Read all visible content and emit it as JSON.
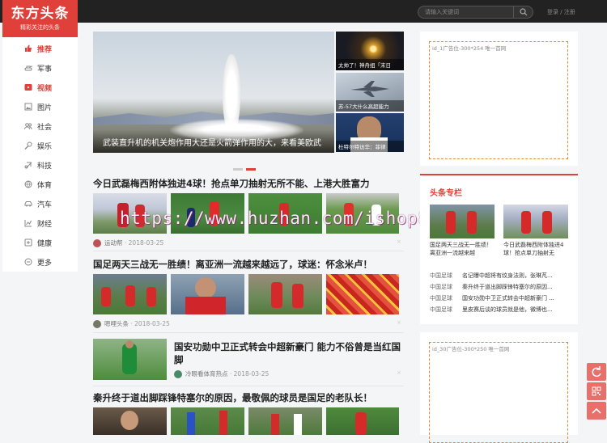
{
  "header": {
    "logo_title": "东方头条",
    "logo_slogan": "精彩关注的头条",
    "search_placeholder": "请输入关键词",
    "login": "登录 / 注册"
  },
  "sidebar": {
    "items": [
      {
        "label": "推荐",
        "icon": "thumb-up-icon",
        "active": true
      },
      {
        "label": "军事",
        "icon": "tank-icon"
      },
      {
        "label": "视频",
        "icon": "video-icon",
        "active": true
      },
      {
        "label": "图片",
        "icon": "image-icon"
      },
      {
        "label": "社会",
        "icon": "people-icon"
      },
      {
        "label": "娱乐",
        "icon": "microphone-icon"
      },
      {
        "label": "科技",
        "icon": "tech-icon"
      },
      {
        "label": "体育",
        "icon": "ball-icon"
      },
      {
        "label": "汽车",
        "icon": "car-icon"
      },
      {
        "label": "财经",
        "icon": "chart-icon"
      },
      {
        "label": "健康",
        "icon": "health-icon"
      },
      {
        "label": "更多",
        "icon": "more-icon"
      }
    ]
  },
  "hero": {
    "caption": "武装直升机的机关炮作用大还是火箭弹作用的大，来看美欧武"
  },
  "side_thumbs": [
    {
      "caption": "太帅了！神舟组「末日"
    },
    {
      "caption": "苏-57大什么高超能力"
    },
    {
      "caption": "杜特尔特访华：菲律"
    }
  ],
  "articles": [
    {
      "title": "今日武磊梅西附体独进4球！抢点单刀抽射无所不能、上港大胜富力",
      "source": "运动帮",
      "date": "2018-03-25"
    },
    {
      "title": "国足两天三战无一胜绩！离亚洲一流越来越远了，球迷：怀念米卢！",
      "source": "嗯哩头条",
      "date": "2018-03-25"
    },
    {
      "title": "国安功勋中卫正式转会中超新豪门 能力不俗曾是当红国脚",
      "source": "冷眼看体育热点",
      "date": "2018-03-25"
    },
    {
      "title": "秦升终于道出脚踩锋特塞尔的原因，最敬佩的球员是国足的老队长！"
    }
  ],
  "dismiss": "×",
  "watermark": "https://www.huzhan.com/ishop8803",
  "right": {
    "ad1": "id_1广告位-300*254 唯一首网",
    "hot_title": "头条专栏",
    "hot_cards": [
      {
        "text": "国足两天三战无一胜绩！离亚洲一流越来越"
      },
      {
        "text": "今日武磊梅西附体独进4球！抢点单刀抽射无"
      }
    ],
    "hot_list": [
      {
        "tag": "中国足球",
        "text": "名记曝中超将有纹身法则，张琳芃..."
      },
      {
        "tag": "中国足球",
        "text": "秦升终于道出脚踩锋特塞尔的原因..."
      },
      {
        "tag": "中国足球",
        "text": "国安功勋中卫正式转会中超新豪门 ..."
      },
      {
        "tag": "中国足球",
        "text": "里皮赛后谈的球员就是他，微博也..."
      }
    ],
    "ad2": "id_30广告位-300*250 唯一首网"
  }
}
